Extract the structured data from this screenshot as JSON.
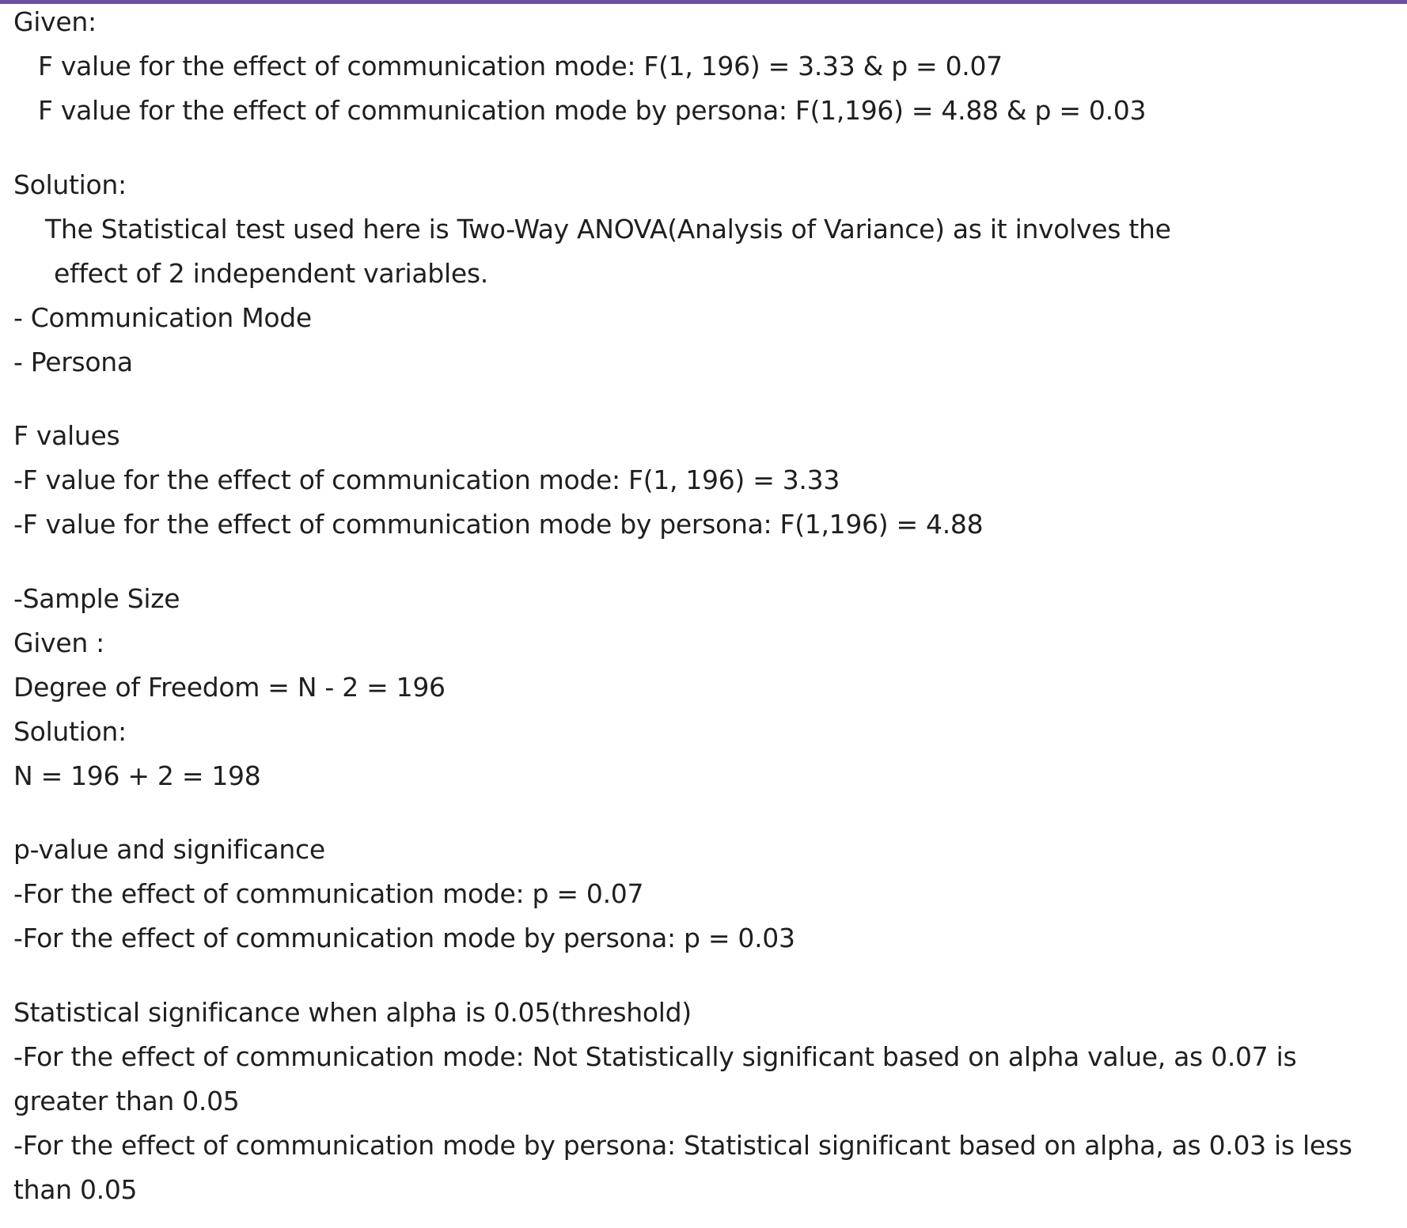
{
  "given": {
    "heading": "Given:",
    "lines": [
      "F value for the effect of communication mode: F(1, 196) = 3.33 & p = 0.07",
      "F value for the effect of communication mode by persona: F(1,196) = 4.88 & p = 0.03"
    ]
  },
  "solution": {
    "heading": "Solution:",
    "intro": [
      "The Statistical test used here is Two-Way ANOVA(Analysis of Variance) as it involves the",
      "effect of 2 independent variables."
    ],
    "variables": [
      "- Communication Mode",
      "- Persona"
    ]
  },
  "f_values": {
    "heading": "F values",
    "lines": [
      "-F value for the effect of communication mode: F(1, 196) = 3.33",
      "-F value for the effect of communication mode by persona: F(1,196) = 4.88"
    ]
  },
  "sample_size": {
    "heading": "-Sample Size",
    "given": "Given :",
    "dof": "Degree of Freedom = N - 2 = 196",
    "solution": "Solution:",
    "n": "N = 196 + 2 = 198"
  },
  "p_value": {
    "heading": "p-value and significance",
    "lines": [
      "-For the effect of communication mode: p = 0.07",
      "-For the effect of communication mode by persona: p = 0.03"
    ]
  },
  "significance": {
    "heading": "Statistical significance when alpha is 0.05(threshold)",
    "lines": [
      "-For the effect of communication mode: Not Statistically significant based on alpha value, as 0.07 is",
      "greater than 0.05",
      "-For the effect of communication mode by persona: Statistical significant based on alpha, as 0.03 is less",
      "than 0.05"
    ]
  }
}
